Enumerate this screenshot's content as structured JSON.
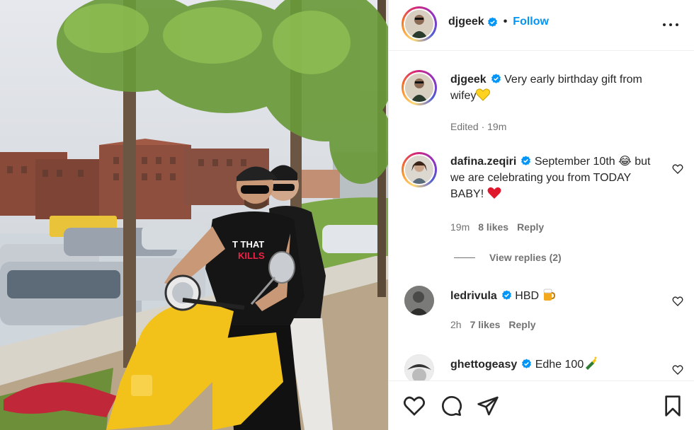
{
  "post": {
    "username": "djgeek",
    "follow_label": "Follow",
    "separator": "•"
  },
  "caption": {
    "username": "djgeek",
    "text": "Very early birthday gift from wifey",
    "emoji": "yellow-heart-icon",
    "edited": "Edited · 19m"
  },
  "comments": [
    {
      "username": "dafina.zeqiri",
      "verified": true,
      "text": "September 10th 😂 but we are celebrating you from TODAY BABY!",
      "emoji": "red-heart-icon",
      "time": "19m",
      "likes": "8 likes",
      "reply_label": "Reply",
      "view_replies": "View replies (2)"
    },
    {
      "username": "ledrivula",
      "verified": true,
      "text": "HBD",
      "emoji": "beer-mug-icon",
      "time": "2h",
      "likes": "7 likes",
      "reply_label": "Reply"
    },
    {
      "username": "ghettogeasy",
      "verified": true,
      "text": "Edhe 100",
      "emoji": "champagne-bottle-icon"
    }
  ],
  "action_icons": [
    "like-heart-icon",
    "comment-icon",
    "share-send-icon",
    "save-bookmark-icon"
  ],
  "photo": {
    "scooter_color": "#f2c21b",
    "shirt_text": "T THAT\nKILLS"
  },
  "colors": {
    "follow": "#0095f6",
    "verified": "#0095f6",
    "muted": "#737373"
  }
}
